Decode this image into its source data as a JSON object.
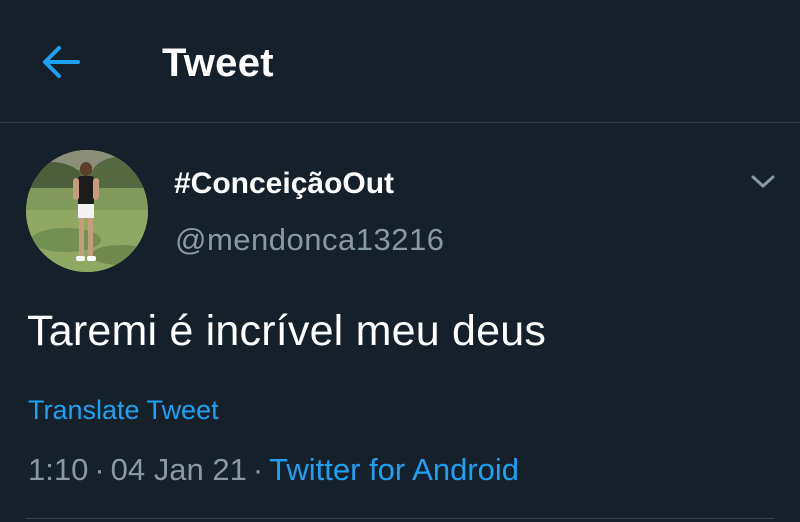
{
  "header": {
    "back_icon": "arrow-left-icon",
    "title": "Tweet"
  },
  "tweet": {
    "display_name": "#ConceiçãoOut",
    "handle": "@mendonca13216",
    "menu_icon": "chevron-down-icon",
    "text": "Taremi é incrível meu deus",
    "translate_label": "Translate Tweet",
    "time": "1:10",
    "separator": "·",
    "date": "04 Jan 21",
    "source": "Twitter for Android"
  },
  "colors": {
    "background": "#15202b",
    "accent": "#1da1f2",
    "secondary_text": "#8899a6",
    "primary_text": "#ffffff"
  }
}
